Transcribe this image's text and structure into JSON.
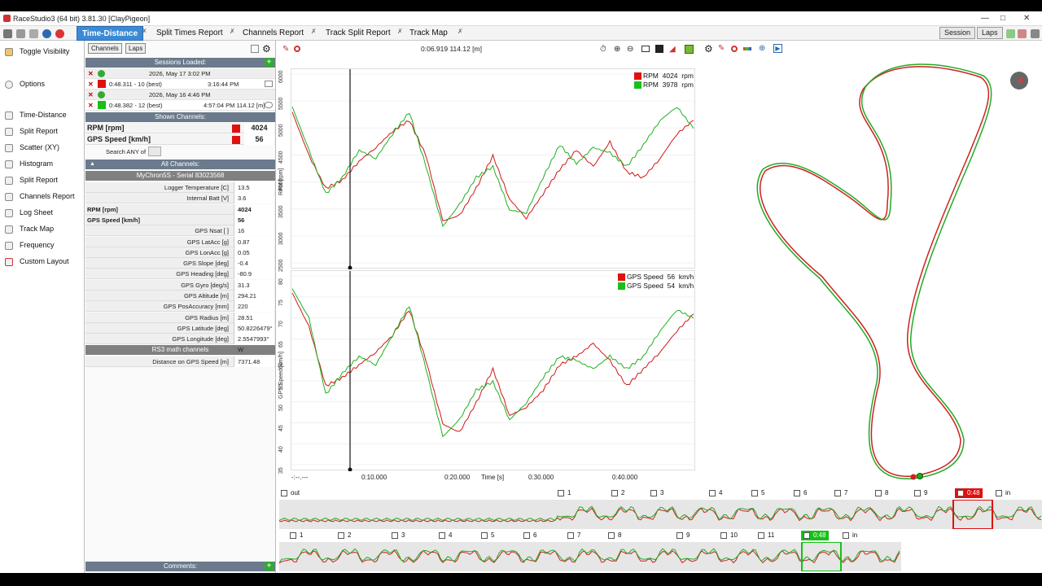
{
  "window": {
    "title": "RaceStudio3 (64 bit) 3.81.30 [ClayPigeon]"
  },
  "tabs": [
    {
      "label": "Time-Distance",
      "active": true
    },
    {
      "label": "Split Times Report"
    },
    {
      "label": "Channels Report"
    },
    {
      "label": "Track Split Report"
    },
    {
      "label": "Track Map"
    }
  ],
  "right_buttons": {
    "session": "Session",
    "laps": "Laps"
  },
  "nav": {
    "toggle_visibility": "Toggle Visibility",
    "options": "Options",
    "items": [
      "Time-Distance",
      "Split Report",
      "Scatter (XY)",
      "Histogram",
      "Split Report",
      "Channels Report",
      "Log Sheet",
      "Track Map",
      "Frequency",
      "Custom Layout"
    ]
  },
  "panel": {
    "channels_btn": "Channels",
    "laps_btn": "Laps",
    "sessions_loaded": "Sessions Loaded:",
    "sessions": [
      {
        "date": "2026, May 17 3:02 PM",
        "lap": "0:48.311 - 10 (best)",
        "time": "3:16:44 PM",
        "color": "#e01010"
      },
      {
        "date": "2026, May 16 4:46 PM",
        "lap": "0:48.382 - 12 (best)",
        "time": "4:57:04 PM 114.12 [m]",
        "color": "#18c018"
      }
    ],
    "shown_channels": "Shown Channels:",
    "shown": [
      {
        "name": "RPM [rpm]",
        "value": "4024",
        "color": "#e01010"
      },
      {
        "name": "GPS Speed [km/h]",
        "value": "56",
        "color": "#e01010"
      }
    ],
    "search_label": "Search ANY of",
    "all_channels": "All Channels:",
    "device": "MyChron5S - Serial 83023568",
    "channels": [
      {
        "name": "Logger Temperature [C]",
        "value": "13.5"
      },
      {
        "name": "Internal Batt [V]",
        "value": "3.6"
      },
      {
        "name": "RPM [rpm]",
        "value": "4024",
        "bold": true
      },
      {
        "name": "GPS Speed [km/h]",
        "value": "56",
        "bold": true
      },
      {
        "name": "GPS Nsat [ ]",
        "value": "16"
      },
      {
        "name": "GPS LatAcc [g]",
        "value": "0.87"
      },
      {
        "name": "GPS LonAcc [g]",
        "value": "0.05"
      },
      {
        "name": "GPS Slope [deg]",
        "value": "-0.4"
      },
      {
        "name": "GPS Heading [deg]",
        "value": "-80.9"
      },
      {
        "name": "GPS Gyro [deg/s]",
        "value": "31.3"
      },
      {
        "name": "GPS Altitude [m]",
        "value": "294.21"
      },
      {
        "name": "GPS PosAccuracy [mm]",
        "value": "220"
      },
      {
        "name": "GPS Radius [m]",
        "value": "28.51"
      },
      {
        "name": "GPS Latitude [deg]",
        "value": "50.8226479° N"
      },
      {
        "name": "GPS Longitude [deg]",
        "value": "2.5547993° W"
      }
    ],
    "math_header": "RS3 math channels",
    "math": [
      {
        "name": "Distance on GPS Speed [m]",
        "value": "7371.48"
      }
    ],
    "comments": "Comments:"
  },
  "cursor_readout": "0:06.919 114.12 [m]",
  "chart_data": [
    {
      "type": "line",
      "ylabel": "RPM [rpm]",
      "ylim": [
        2500,
        6000
      ],
      "yticks": [
        "6000",
        "5500",
        "5000",
        "4500",
        "4000",
        "3500",
        "3000",
        "2500"
      ],
      "series": [
        {
          "name": "RPM",
          "value": "4024",
          "unit": "rpm",
          "color": "#e01010"
        },
        {
          "name": "RPM",
          "value": "3978",
          "unit": "rpm",
          "color": "#18c018"
        }
      ],
      "x": [
        0,
        2,
        4,
        6,
        8,
        10,
        12,
        14,
        16,
        18,
        20,
        22,
        24,
        26,
        28,
        30,
        32,
        34,
        36,
        38,
        40,
        42,
        44,
        46,
        48
      ],
      "red": [
        5300,
        4500,
        3900,
        4050,
        4400,
        4650,
        4950,
        5150,
        4500,
        3300,
        3400,
        3900,
        4500,
        3700,
        3350,
        3800,
        4250,
        4600,
        4300,
        4750,
        4200,
        4100,
        4450,
        4900,
        5150
      ],
      "green": [
        5400,
        4600,
        3800,
        4100,
        4600,
        4450,
        4900,
        5300,
        4300,
        3200,
        3600,
        4100,
        4300,
        3500,
        3450,
        4100,
        4700,
        4350,
        4650,
        4550,
        4300,
        4700,
        5150,
        5400,
        5000
      ]
    },
    {
      "type": "line",
      "ylabel": "GPS Speed [km/h]",
      "ylim": [
        35,
        80
      ],
      "yticks": [
        "80",
        "75",
        "70",
        "65",
        "60",
        "55",
        "50",
        "45",
        "40",
        "35"
      ],
      "series": [
        {
          "name": "GPS Speed",
          "value": "56",
          "unit": "km/h",
          "color": "#e01010"
        },
        {
          "name": "GPS Speed",
          "value": "54",
          "unit": "km/h",
          "color": "#18c018"
        }
      ],
      "x": [
        0,
        2,
        4,
        6,
        8,
        10,
        12,
        14,
        16,
        18,
        20,
        22,
        24,
        26,
        28,
        30,
        32,
        34,
        36,
        38,
        40,
        42,
        44,
        46,
        48
      ],
      "red": [
        76,
        68,
        54,
        56,
        59,
        62,
        66,
        72,
        60,
        45,
        43,
        50,
        58,
        47,
        49,
        53,
        59,
        61,
        64,
        60,
        54,
        58,
        62,
        67,
        71
      ],
      "green": [
        77,
        70,
        52,
        57,
        61,
        59,
        66,
        73,
        58,
        42,
        46,
        53,
        55,
        46,
        50,
        56,
        61,
        60,
        58,
        61,
        58,
        61,
        67,
        72,
        70
      ]
    }
  ],
  "x_axis": {
    "ticks": [
      "-:--.---",
      "0:10.000",
      "0:20.000",
      "0:30.000",
      "0:40.000"
    ],
    "label": "Time [s]"
  },
  "laps_row1": [
    "out",
    "1",
    "2",
    "3",
    "4",
    "5",
    "6",
    "7",
    "8",
    "9",
    "0:48",
    "in"
  ],
  "laps_row2": [
    "1",
    "2",
    "3",
    "4",
    "5",
    "6",
    "7",
    "8",
    "9",
    "10",
    "11",
    "0:48",
    "in"
  ]
}
